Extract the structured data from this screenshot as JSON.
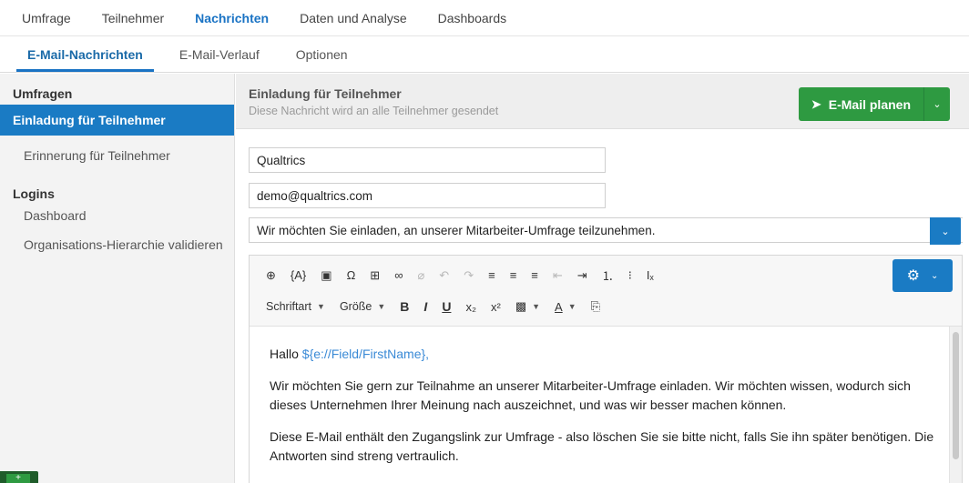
{
  "top_nav": {
    "tabs": [
      "Umfrage",
      "Teilnehmer",
      "Nachrichten",
      "Daten und Analyse",
      "Dashboards"
    ],
    "active": "Nachrichten"
  },
  "sub_nav": {
    "tabs": [
      "E-Mail-Nachrichten",
      "E-Mail-Verlauf",
      "Optionen"
    ],
    "active": "E-Mail-Nachrichten"
  },
  "sidebar": {
    "section_surveys": "Umfragen",
    "item_invite": "Einladung für Teilnehmer",
    "item_reminder": "Erinnerung für Teilnehmer",
    "section_logins": "Logins",
    "item_dashboard": "Dashboard",
    "item_org": "Organisations-Hierarchie validieren"
  },
  "message_header": {
    "title": "Einladung für Teilnehmer",
    "subtitle": "Diese Nachricht wird an alle Teilnehmer gesendet",
    "schedule_button": "E-Mail planen"
  },
  "form": {
    "from_name": "Qualtrics",
    "from_email": "demo@qualtrics.com",
    "subject": "Wir möchten Sie einladen, an unserer Mitarbeiter-Umfrage teilzunehmen."
  },
  "toolbar": {
    "row1": [
      {
        "name": "globe-icon",
        "glyph": "⊕",
        "dim": false
      },
      {
        "name": "piped-text-icon",
        "glyph": "{A}",
        "dim": false
      },
      {
        "name": "image-icon",
        "glyph": "▣",
        "dim": false
      },
      {
        "name": "omega-icon",
        "glyph": "Ω",
        "dim": false
      },
      {
        "name": "table-icon",
        "glyph": "⊞",
        "dim": false
      },
      {
        "name": "link-icon",
        "glyph": "∞",
        "dim": false
      },
      {
        "name": "unlink-icon",
        "glyph": "⌀",
        "dim": true
      },
      {
        "name": "undo-icon",
        "glyph": "↶",
        "dim": true
      },
      {
        "name": "redo-icon",
        "glyph": "↷",
        "dim": true
      },
      {
        "name": "align-left-icon",
        "glyph": "≡",
        "dim": false
      },
      {
        "name": "align-center-icon",
        "glyph": "≡",
        "dim": false
      },
      {
        "name": "align-right-icon",
        "glyph": "≡",
        "dim": false
      },
      {
        "name": "outdent-icon",
        "glyph": "⇤",
        "dim": true
      },
      {
        "name": "indent-icon",
        "glyph": "⇥",
        "dim": false
      },
      {
        "name": "numbered-list-icon",
        "glyph": "⒈",
        "dim": false
      },
      {
        "name": "bullet-list-icon",
        "glyph": "⁝",
        "dim": false
      },
      {
        "name": "clear-format-icon",
        "glyph": "Iₓ",
        "dim": false
      }
    ],
    "font_label": "Schriftart",
    "size_label": "Größe",
    "bold": "B",
    "italic": "I",
    "underline": "U",
    "subscript": "x₂",
    "superscript": "x²",
    "bg_color": "▩",
    "text_color": "A",
    "source": "⎘"
  },
  "content": {
    "greeting": "Hallo ",
    "piped_field": "${e://Field/FirstName},",
    "para1": "Wir möchten Sie gern zur Teilnahme an unserer Mitarbeiter-Umfrage einladen.  Wir möchten wissen, wodurch sich dieses Unternehmen Ihrer Meinung nach auszeichnet, und was wir besser machen können.",
    "para2": "Diese E-Mail enthält den Zugangslink zur Umfrage - also löschen Sie sie bitte nicht, falls Sie ihn später benötigen.   Die Antworten sind streng vertraulich."
  },
  "colors": {
    "accent_blue": "#1a7bc4",
    "green_button": "#2e9a41",
    "piped_text": "#3a8ad6"
  }
}
